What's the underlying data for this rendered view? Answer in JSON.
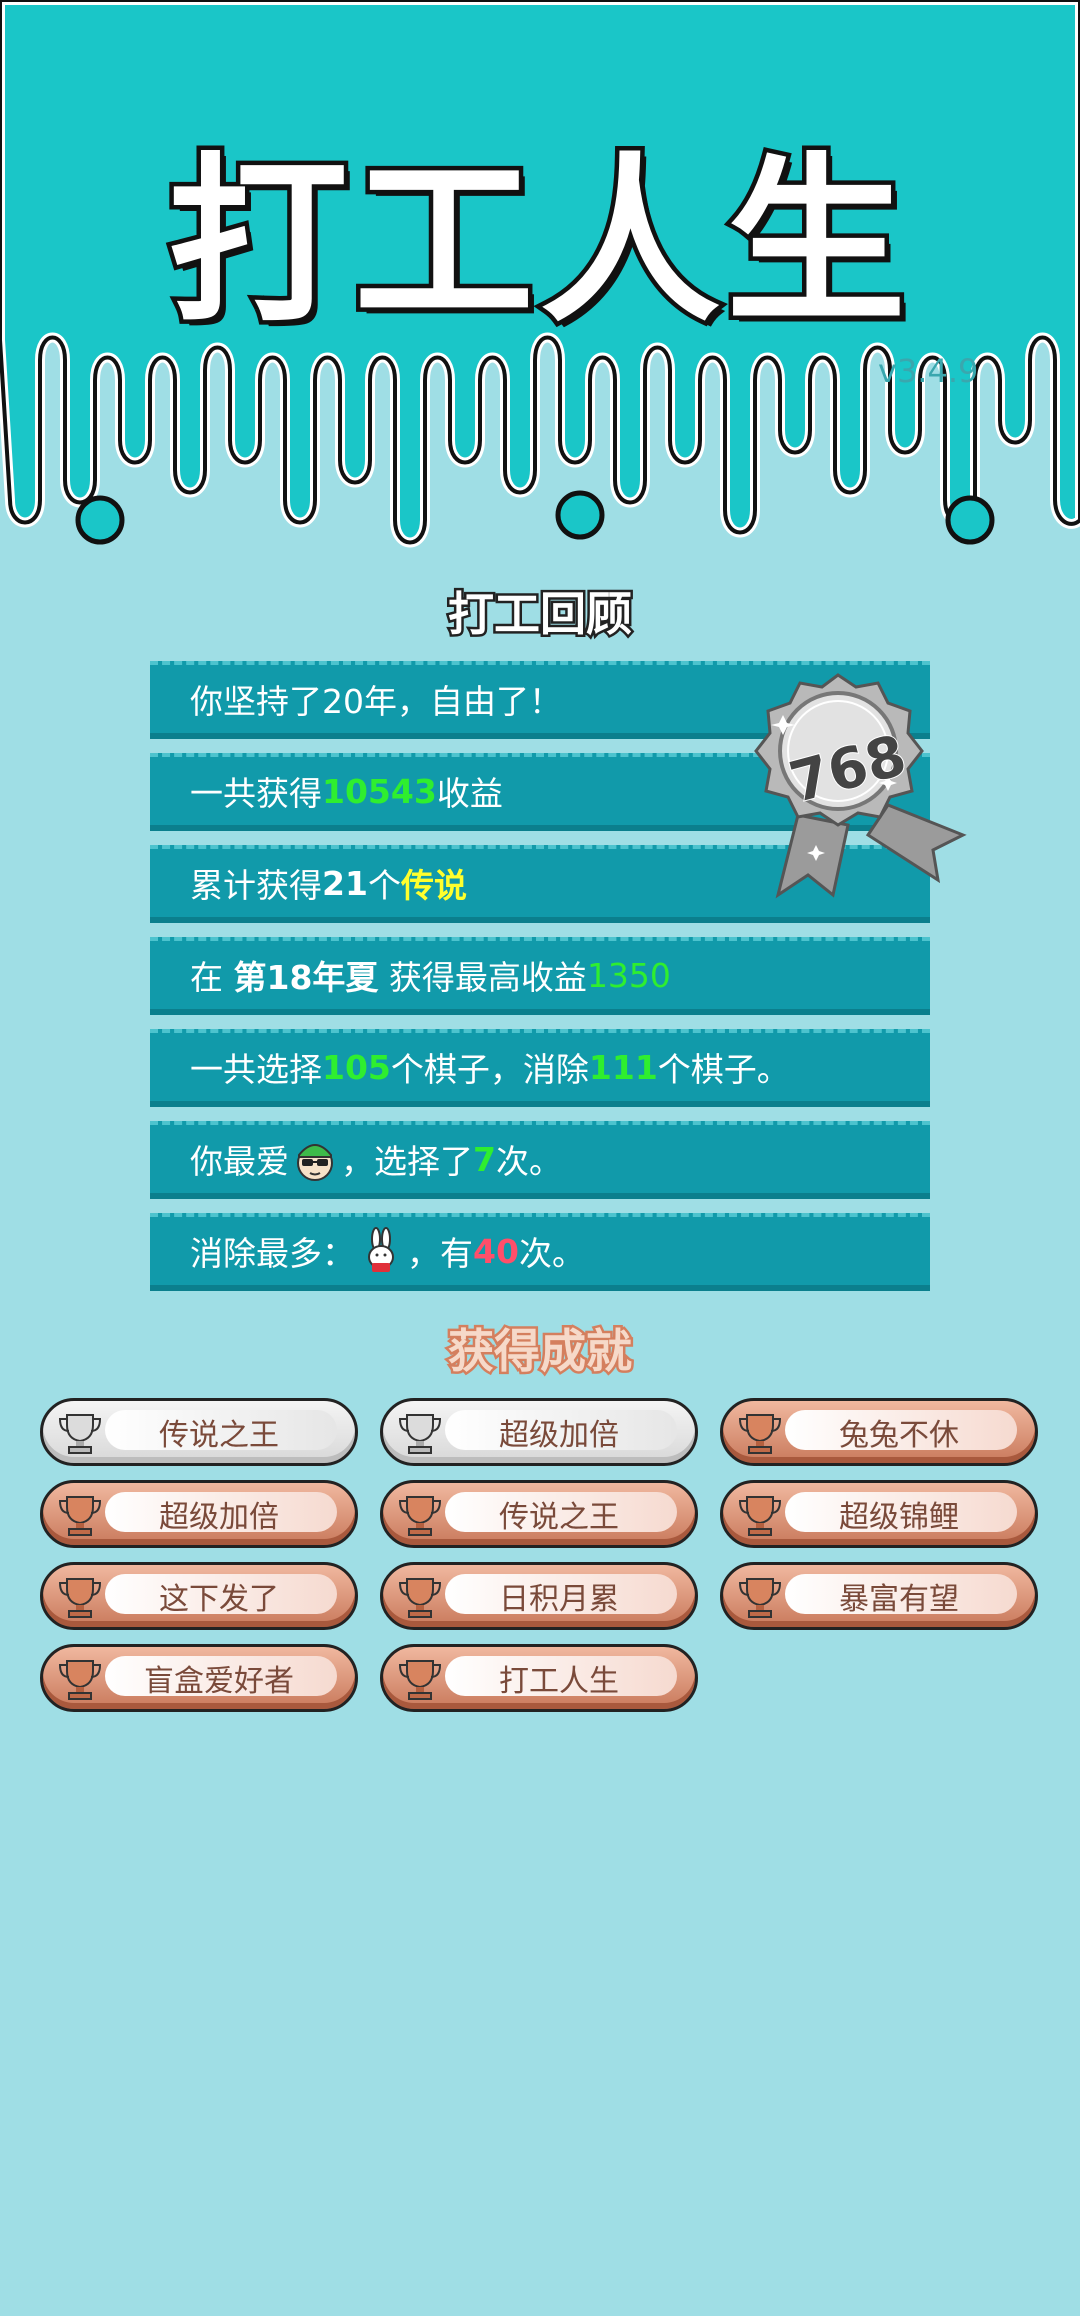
{
  "header": {
    "title": "打工人生",
    "version": "v3.4.9"
  },
  "review": {
    "title": "打工回顾",
    "badge_score": "768",
    "rows": {
      "r1": {
        "text": "你坚持了20年，自由了！"
      },
      "r2": {
        "pre": "一共获得",
        "value": "10543",
        "post": "收益"
      },
      "r3": {
        "pre": "累计获得",
        "count": "21",
        "mid": "个",
        "tag": "传说"
      },
      "r4": {
        "pre": "在 ",
        "season": "第18年夏",
        "mid": " 获得最高收益",
        "value": "1350"
      },
      "r5": {
        "pre": "一共选择",
        "sel": "105",
        "mid": "个棋子，消除",
        "elim": "111",
        "post": "个棋子。"
      },
      "r6": {
        "pre": "你最爱",
        "mid": "，选择了",
        "count": "7",
        "post": "次。"
      },
      "r7": {
        "pre": "消除最多：",
        "mid": "，有",
        "count": "40",
        "post": "次。"
      }
    }
  },
  "achievements": {
    "title": "获得成就",
    "items": [
      {
        "label": "传说之王",
        "tier": "silver"
      },
      {
        "label": "超级加倍",
        "tier": "silver"
      },
      {
        "label": "兔兔不休",
        "tier": "bronze"
      },
      {
        "label": "超级加倍",
        "tier": "bronze"
      },
      {
        "label": "传说之王",
        "tier": "bronze"
      },
      {
        "label": "超级锦鲤",
        "tier": "bronze"
      },
      {
        "label": "这下发了",
        "tier": "bronze"
      },
      {
        "label": "日积月累",
        "tier": "bronze"
      },
      {
        "label": "暴富有望",
        "tier": "bronze"
      },
      {
        "label": "盲盒爱好者",
        "tier": "bronze"
      },
      {
        "label": "打工人生",
        "tier": "bronze"
      }
    ]
  },
  "colors": {
    "header": "#1ac6c8",
    "background": "#9fdee5",
    "row": "#119aaa",
    "green": "#2fee2f",
    "yellow": "#ffff2d",
    "red": "#ff4f6a"
  }
}
